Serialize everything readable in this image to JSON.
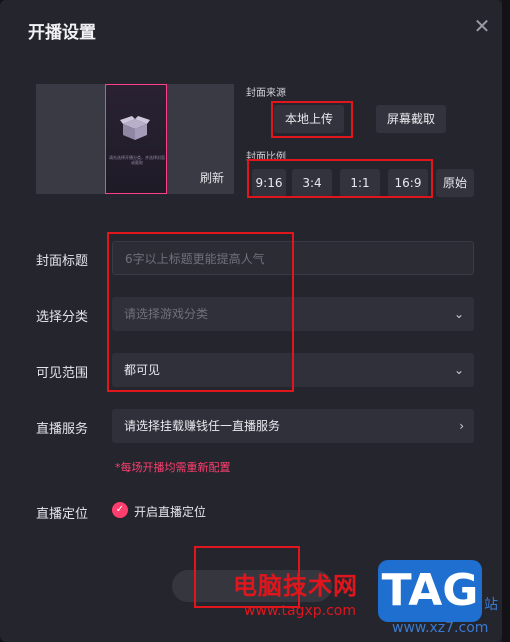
{
  "dialog": {
    "title": "开播设置",
    "close_icon": "close-icon"
  },
  "cover": {
    "refresh_label": "刷新",
    "preview_hint": "请先选择开播分类，并选择封面或截取",
    "source_label": "封面来源",
    "local_upload": "本地上传",
    "screen_capture": "屏幕截取",
    "ratio_label": "封面比例",
    "ratios": [
      "9:16",
      "3:4",
      "1:1",
      "16:9"
    ],
    "original": "原始"
  },
  "form": {
    "title_label": "封面标题",
    "title_placeholder": "6字以上标题更能提高人气",
    "category_label": "选择分类",
    "category_placeholder": "请选择游戏分类",
    "visibility_label": "可见范围",
    "visibility_value": "都可见",
    "service_label": "直播服务",
    "service_value": "请选择挂载赚钱任一直播服务",
    "service_note": "*每场开播均需重新配置",
    "location_label": "直播定位",
    "location_option": "开启直播定位",
    "location_checked": true
  },
  "watermark": {
    "site_name": "电脑技术网",
    "url": "www.tagxp.com",
    "tag": "TAG",
    "small": "www.xz7.com",
    "side": "站"
  },
  "colors": {
    "accent": "#ff3e6e",
    "highlight": "#e0161c"
  }
}
